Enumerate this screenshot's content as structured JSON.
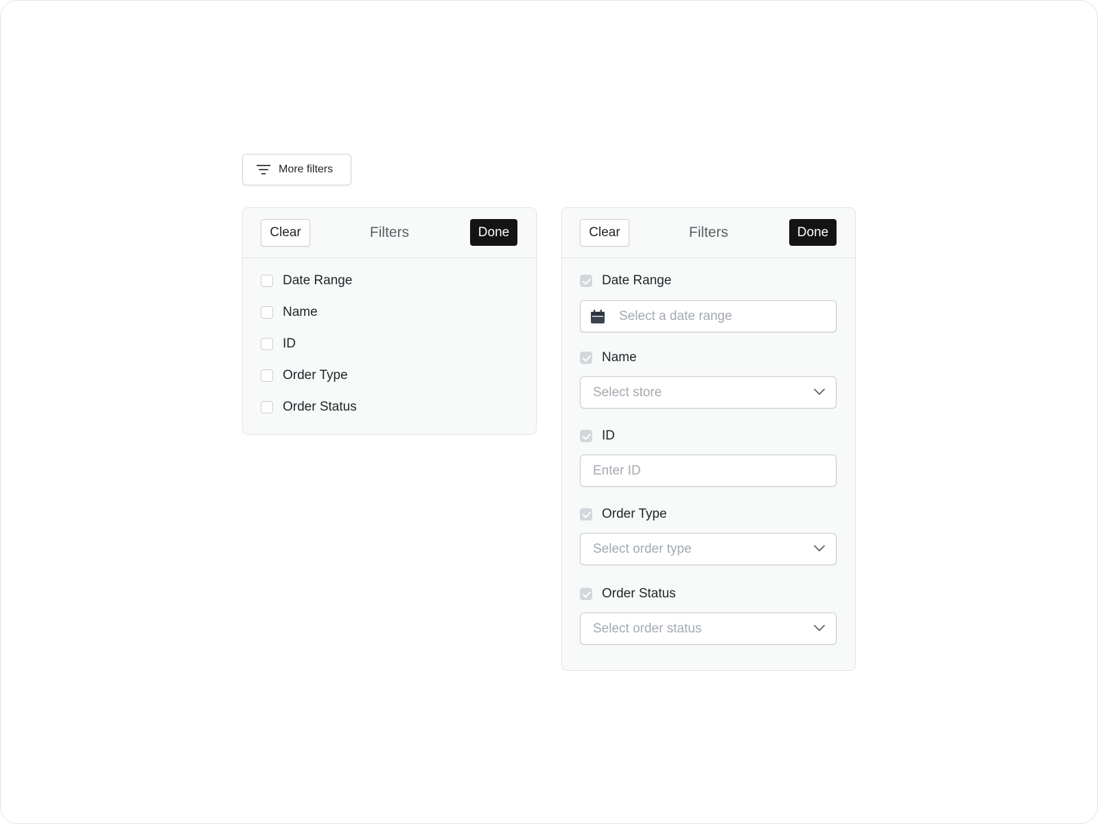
{
  "trigger": {
    "label": "More filters",
    "icon": "filter-lines-icon"
  },
  "panel_collapsed": {
    "clear_label": "Clear",
    "title": "Filters",
    "done_label": "Done",
    "filters": [
      {
        "label": "Date Range",
        "checked": false
      },
      {
        "label": "Name",
        "checked": false
      },
      {
        "label": "ID",
        "checked": false
      },
      {
        "label": "Order Type",
        "checked": false
      },
      {
        "label": "Order Status",
        "checked": false
      }
    ]
  },
  "panel_expanded": {
    "clear_label": "Clear",
    "title": "Filters",
    "done_label": "Done",
    "filters": [
      {
        "label": "Date Range",
        "checked": true,
        "control": "date-picker",
        "placeholder": "Select a date range",
        "icon": "calendar-icon"
      },
      {
        "label": "Name",
        "checked": true,
        "control": "select",
        "placeholder": "Select store",
        "icon": "chevron-down-icon"
      },
      {
        "label": "ID",
        "checked": true,
        "control": "text-input",
        "placeholder": "Enter ID"
      },
      {
        "label": "Order Type",
        "checked": true,
        "control": "select",
        "placeholder": "Select order type",
        "icon": "chevron-down-icon"
      },
      {
        "label": "Order Status",
        "checked": true,
        "control": "select",
        "placeholder": "Select order status",
        "icon": "chevron-down-icon"
      }
    ]
  },
  "colors": {
    "done_button_bg": "#141414",
    "checked_box": "#d3d7dc",
    "panel_bg": "#f8f9f9",
    "placeholder_text": "#a3a9b0"
  }
}
